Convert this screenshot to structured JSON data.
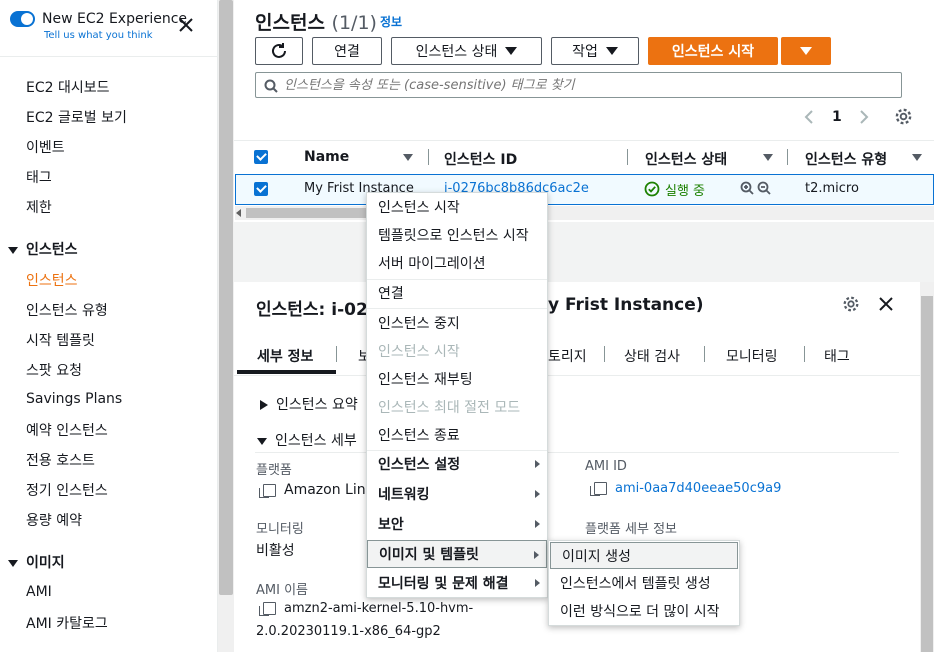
{
  "sidebar": {
    "new_experience": "New EC2 Experience",
    "feedback_link": "Tell us what you think",
    "items_top": [
      "EC2 대시보드",
      "EC2 글로벌 보기",
      "이벤트",
      "태그",
      "제한"
    ],
    "section_instances": "인스턴스",
    "instances_items": [
      "인스턴스",
      "인스턴스 유형",
      "시작 템플릿",
      "스팟 요청",
      "Savings Plans",
      "예약 인스턴스",
      "전용 호스트",
      "정기 인스턴스",
      "용량 예약"
    ],
    "section_images": "이미지",
    "images_items": [
      "AMI",
      "AMI 카탈로그"
    ]
  },
  "header": {
    "title": "인스턴스",
    "count": "(1/1)",
    "info": "정보"
  },
  "toolbar": {
    "connect": "연결",
    "instance_state": "인스턴스 상태",
    "actions": "작업",
    "launch": "인스턴스 시작"
  },
  "search": {
    "placeholder": "인스턴스을 속성 또는 (case-sensitive) 태그로 찾기"
  },
  "pagination": {
    "page": "1"
  },
  "table": {
    "columns": [
      "Name",
      "인스턴스 ID",
      "인스턴스 상태",
      "인스턴스 유형"
    ],
    "row": {
      "name": "My Frist Instance",
      "id": "i-0276bc8b86dc6ac2e",
      "state": "실행 중",
      "type": "t2.micro"
    }
  },
  "detail": {
    "title_left": "인스턴스: i-02",
    "title_right": "y Frist Instance)",
    "tabs": [
      "세부 정보",
      "보",
      "토리지",
      "상태 검사",
      "모니터링",
      "태그"
    ],
    "summary_section": "인스턴스 요약",
    "details_section": "인스턴스 세부",
    "platform_label": "플랫폼",
    "platform_value": "Amazon Linu",
    "monitoring_label": "모니터링",
    "monitoring_value": "비활성",
    "ami_name_label": "AMI 이름",
    "ami_name_value_1": "amzn2-ami-kernel-5.10-hvm-",
    "ami_name_value_2": "2.0.20230119.1-x86_64-gp2",
    "ami_id_label": "AMI ID",
    "ami_id_value": "ami-0aa7d40eeae50c9a9",
    "platform_detail_label": "플랫폼 세부 정보"
  },
  "context_menu": {
    "items": [
      "인스턴스 시작",
      "템플릿으로 인스턴스 시작",
      "서버 마이그레이션",
      "연결",
      "인스턴스 중지",
      "인스턴스 시작",
      "인스턴스 재부팅",
      "인스턴스 최대 절전 모드",
      "인스턴스 종료",
      "인스턴스 설정",
      "네트워킹",
      "보안",
      "이미지 및 템플릿",
      "모니터링 및 문제 해결"
    ]
  },
  "submenu": {
    "items": [
      "이미지 생성",
      "인스턴스에서 템플릿 생성",
      "이런 방식으로 더 많이 시작"
    ]
  },
  "colors": {
    "accent": "#ec7211",
    "link": "#0972d3",
    "success": "#1d8102"
  }
}
